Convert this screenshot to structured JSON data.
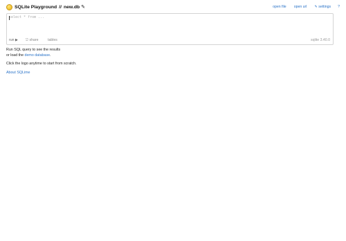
{
  "header": {
    "app_title": "SQLite Playground",
    "separator": "//",
    "db_name": "new.db",
    "edit_icon": "pencil-icon",
    "nav": {
      "open_file": "open file",
      "open_url": "open url",
      "settings": "✎ settings",
      "help": "?"
    }
  },
  "editor": {
    "placeholder": "select * from ...",
    "run_label": "run ▶",
    "share_label": "⎋ share",
    "tables_label": "tables",
    "version": "sqlite 3.40.0"
  },
  "content": {
    "line1": "Run SQL query to see the results",
    "line2_prefix": "or load the ",
    "demo_link": "demo database",
    "line2_suffix": ".",
    "line3": "Click the logo anytime to start from scratch.",
    "about_link": "About SQLime"
  },
  "colors": {
    "link": "#2a73c8",
    "logo": "#f5c93c"
  }
}
